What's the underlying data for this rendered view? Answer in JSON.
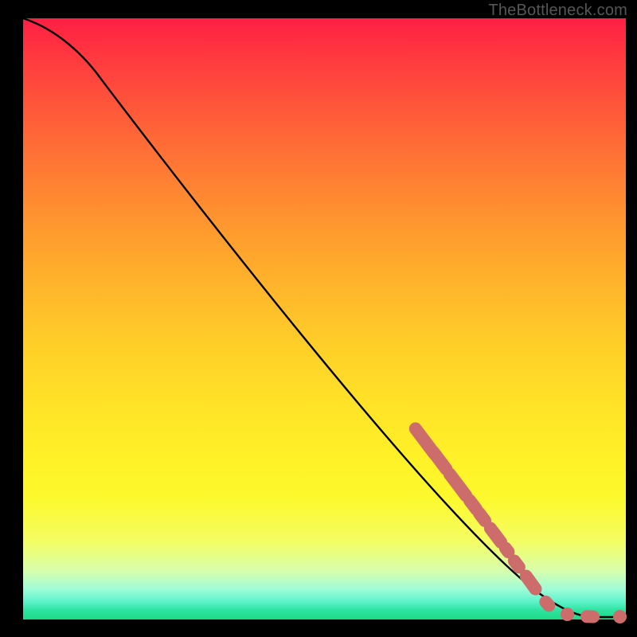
{
  "watermark": "TheBottleneck.com",
  "colors": {
    "marker": "#cd6d6b",
    "line": "#000000",
    "background": "#000000"
  },
  "chart_data": {
    "type": "line",
    "title": "",
    "xlabel": "",
    "ylabel": "",
    "xlim": [
      0,
      100
    ],
    "ylim": [
      0,
      100
    ],
    "grid": false,
    "series": [
      {
        "name": "curve",
        "x": [
          0,
          4,
          8,
          12,
          16,
          20,
          24,
          28,
          32,
          36,
          40,
          44,
          48,
          52,
          56,
          60,
          64,
          68,
          72,
          76,
          80,
          84,
          88,
          90,
          92,
          94,
          96,
          98,
          100
        ],
        "y": [
          100,
          99,
          97,
          94,
          90,
          86,
          81,
          76,
          71,
          66,
          61,
          56,
          51,
          46,
          41,
          36,
          31,
          26,
          21,
          16,
          12,
          8,
          4,
          3,
          2,
          1,
          0.5,
          0.2,
          0.2
        ]
      }
    ],
    "highlighted_markers": {
      "note": "dashed/dotted salmon markers overlaying lower-right portion of the curve",
      "diagonal_segments_x_range": [
        65,
        88
      ],
      "tail_dots_x": [
        92,
        95,
        97,
        100
      ]
    }
  }
}
